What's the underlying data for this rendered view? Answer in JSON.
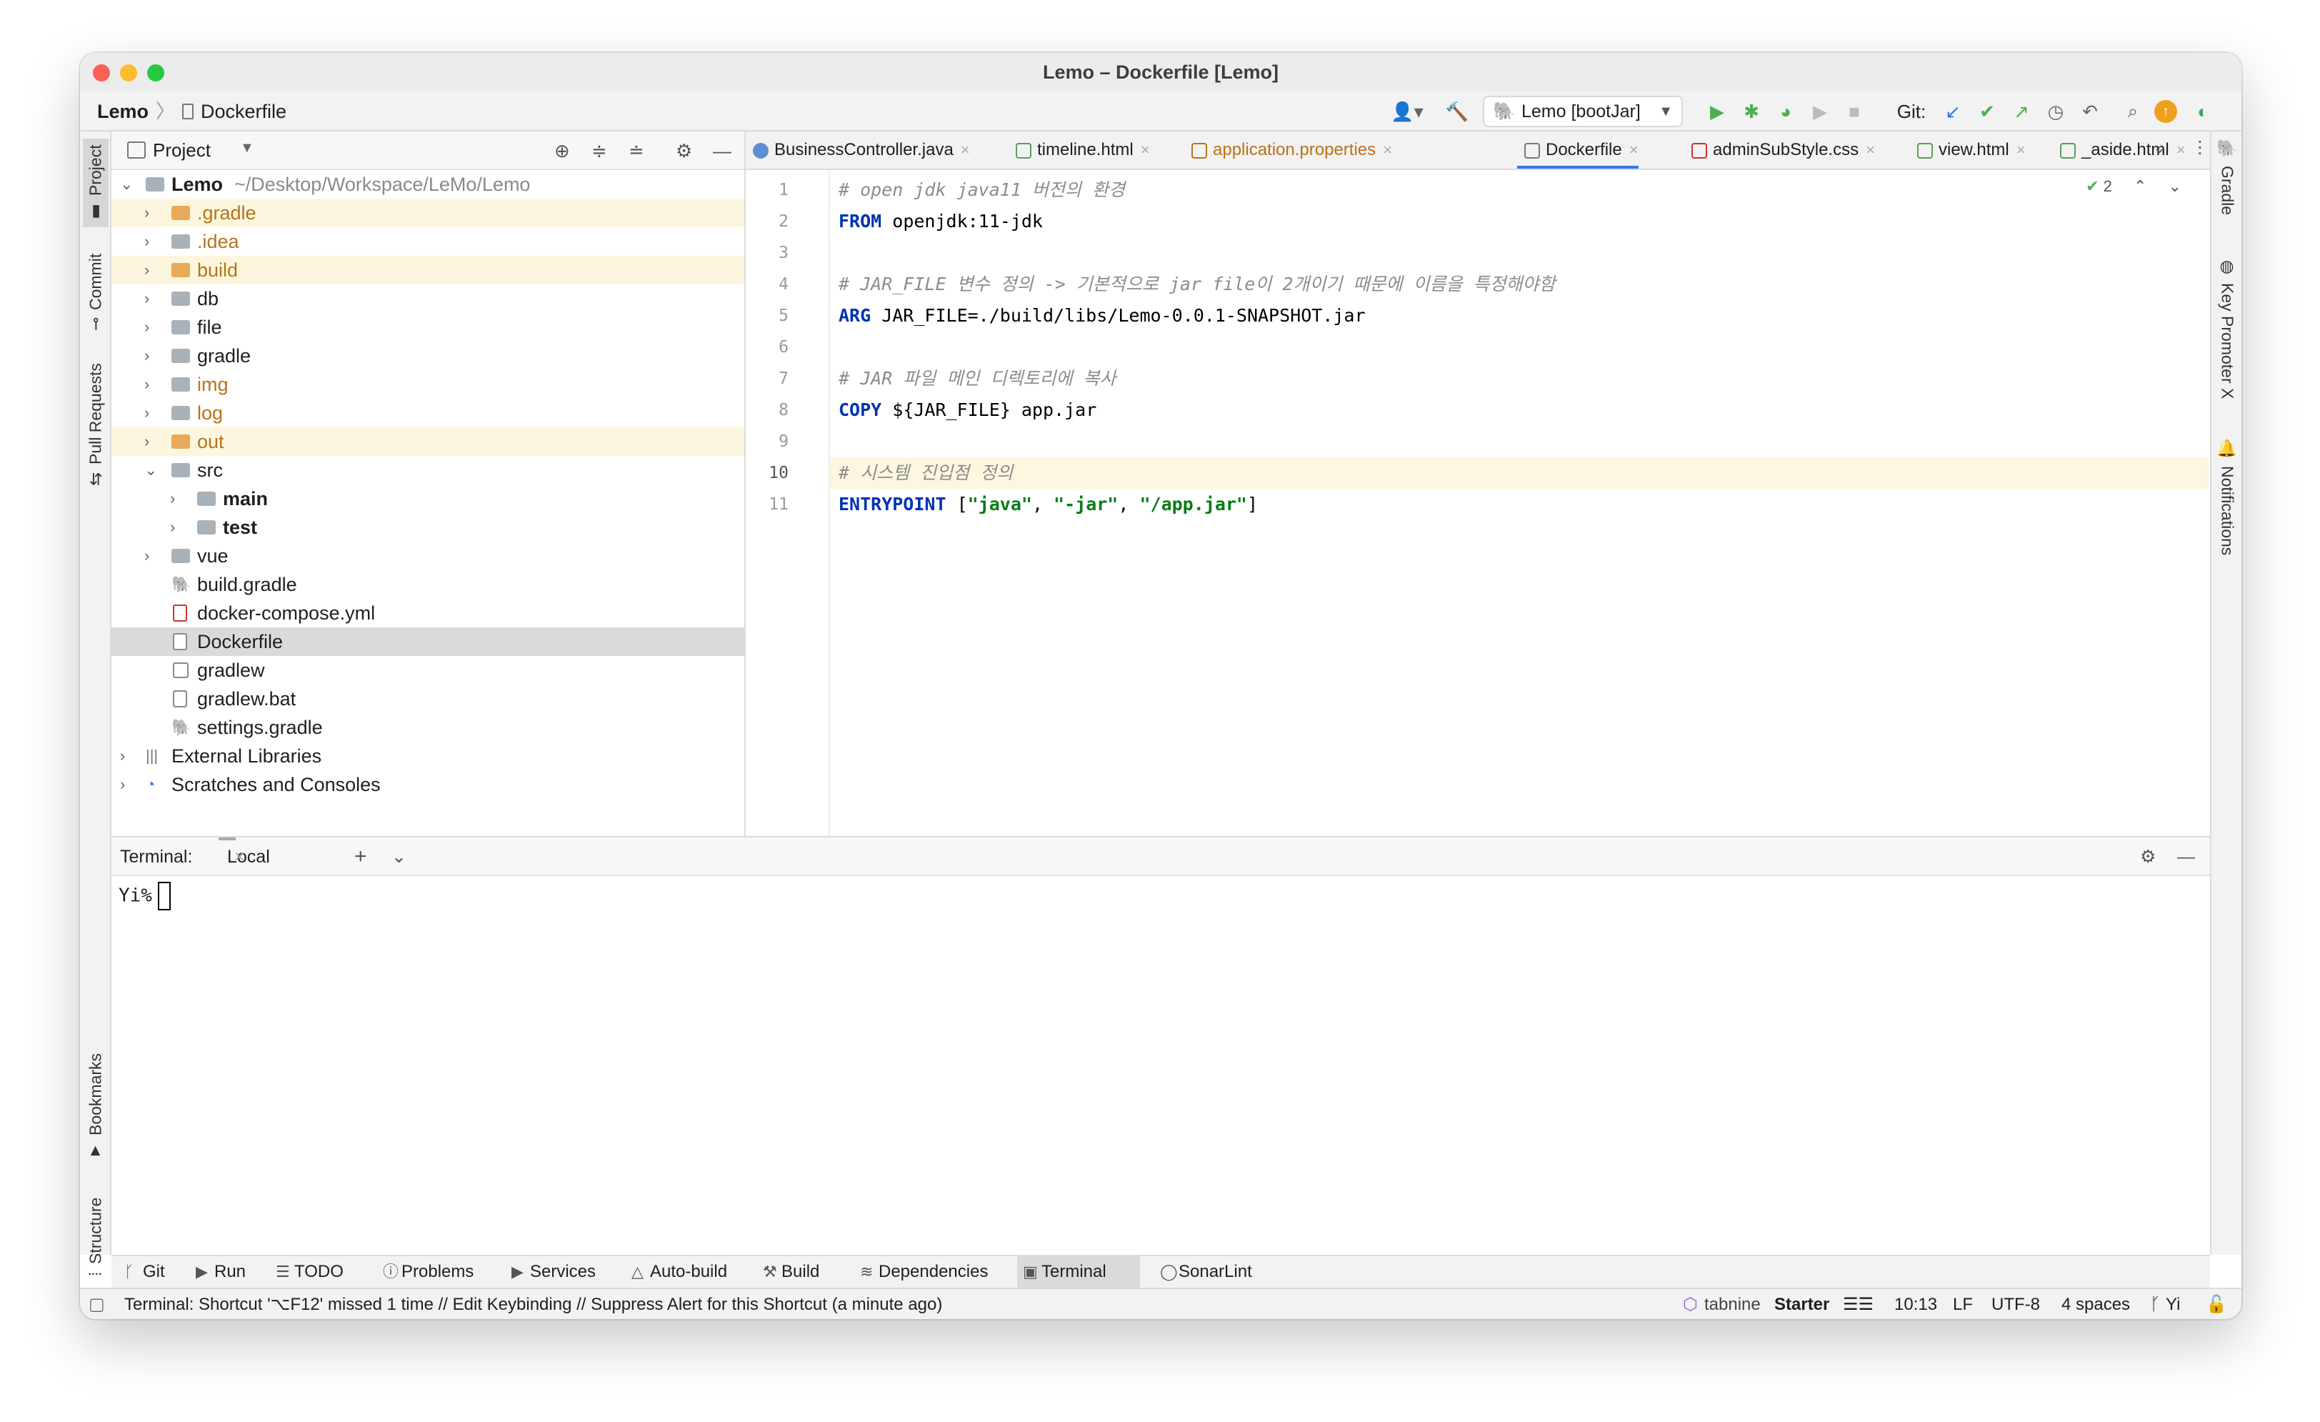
{
  "window": {
    "title": "Lemo – Dockerfile [Lemo]"
  },
  "breadcrumb": {
    "project": "Lemo",
    "file": "Dockerfile"
  },
  "toolbar": {
    "run_config": "Lemo [bootJar]",
    "git_label": "Git:"
  },
  "left_strip": {
    "project": "Project",
    "commit": "Commit",
    "pull_requests": "Pull Requests",
    "bookmarks": "Bookmarks",
    "structure": "Structure"
  },
  "right_strip": {
    "gradle": "Gradle",
    "key_promoter": "Key Promoter X",
    "notifications": "Notifications"
  },
  "project_panel": {
    "title": "Project",
    "root_name": "Lemo",
    "root_path": "~/Desktop/Workspace/LeMo/Lemo",
    "items": [
      {
        "label": ".gradle"
      },
      {
        "label": ".idea"
      },
      {
        "label": "build"
      },
      {
        "label": "db"
      },
      {
        "label": "file"
      },
      {
        "label": "gradle"
      },
      {
        "label": "img"
      },
      {
        "label": "log"
      },
      {
        "label": "out"
      },
      {
        "label": "src"
      },
      {
        "label": "main"
      },
      {
        "label": "test"
      },
      {
        "label": "vue"
      },
      {
        "label": "build.gradle"
      },
      {
        "label": "docker-compose.yml"
      },
      {
        "label": "Dockerfile"
      },
      {
        "label": "gradlew"
      },
      {
        "label": "gradlew.bat"
      },
      {
        "label": "settings.gradle"
      },
      {
        "label": "External Libraries"
      },
      {
        "label": "Scratches and Consoles"
      }
    ]
  },
  "editor": {
    "tabs": [
      {
        "label": "BusinessController.java"
      },
      {
        "label": "timeline.html"
      },
      {
        "label": "application.properties"
      },
      {
        "label": "Dockerfile"
      },
      {
        "label": "adminSubStyle.css"
      },
      {
        "label": "view.html"
      },
      {
        "label": "_aside.html"
      }
    ],
    "inspection_count": "2",
    "line_numbers": [
      "1",
      "2",
      "3",
      "4",
      "5",
      "6",
      "7",
      "8",
      "9",
      "10",
      "11"
    ],
    "code": {
      "l1": "# open jdk java11 버전의 환경",
      "l2_kw": "FROM",
      "l2_rest": " openjdk:11-jdk",
      "l4": "# JAR_FILE 변수 정의 -> 기본적으로 jar file이 2개이기 때문에 이름을 특정해야함",
      "l5_kw": "ARG",
      "l5_rest": " JAR_FILE=./build/libs/Lemo-0.0.1-SNAPSHOT.jar",
      "l7": "# JAR 파일 메인 디렉토리에 복사",
      "l8_kw": "COPY",
      "l8_rest": " ${JAR_FILE} app.jar",
      "l10": "# 시스템 진입점 정의",
      "l11_kw": "ENTRYPOINT",
      "l11_a": " [",
      "l11_s1": "\"java\"",
      "l11_c1": ", ",
      "l11_s2": "\"-jar\"",
      "l11_c2": ", ",
      "l11_s3": "\"/app.jar\"",
      "l11_b": "]"
    }
  },
  "terminal": {
    "label": "Terminal:",
    "tab": "Local",
    "prompt": "Yi%"
  },
  "tool_windows": [
    {
      "label": "Git"
    },
    {
      "label": "Run"
    },
    {
      "label": "TODO"
    },
    {
      "label": "Problems"
    },
    {
      "label": "Services"
    },
    {
      "label": "Auto-build"
    },
    {
      "label": "Build"
    },
    {
      "label": "Dependencies"
    },
    {
      "label": "Terminal"
    },
    {
      "label": "SonarLint"
    }
  ],
  "status_bar": {
    "message": "Terminal: Shortcut '⌥F12' missed 1 time // Edit Keybinding // Suppress Alert for this Shortcut (a minute ago)",
    "tabnine": "tabnine",
    "tabnine_plan": "Starter",
    "position": "10:13",
    "line_sep": "LF",
    "encoding": "UTF-8",
    "indent": "4 spaces",
    "branch": "Yi"
  },
  "colors": {
    "accent": "#3574f0",
    "keyword": "#0033b3",
    "string": "#067d17",
    "comment": "#8c8c8c",
    "folder_excluded": "#e8a958"
  }
}
